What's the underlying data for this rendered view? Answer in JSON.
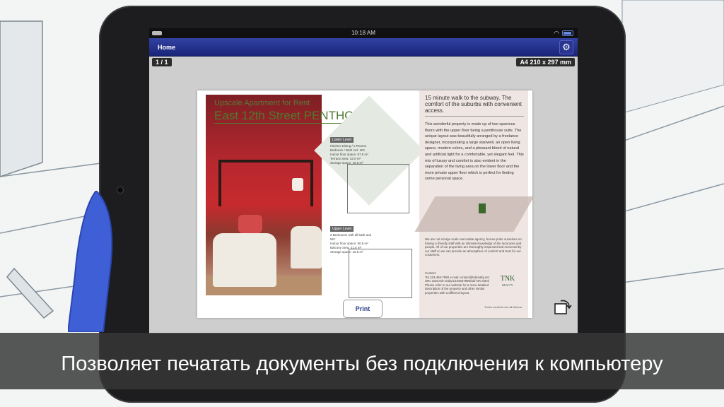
{
  "status_bar": {
    "time": "10:18 AM"
  },
  "nav": {
    "home_label": "Home"
  },
  "toolbar": {
    "page_indicator": "1 / 1",
    "paper_size": "A4 210 x 297 mm",
    "print_label": "Print"
  },
  "document": {
    "kicker": "Upscale Apartment for Rent",
    "headline": "East 12th Street PENTHOUSE",
    "lower_level": {
      "label": "Lower Level",
      "details": "Kitchen-Dining / 2 Rooms\nBedroom / Bath incl. WC\nIndoor floor space: 57.5 m²\nTerrace area: 42.0 m²\nStorage space: 15.5 m²"
    },
    "upper_level": {
      "label": "Upper Level",
      "details": "2 Bedrooms with all bath and WC\nIndoor floor space: 50.5 m²\nBalcony area: 21.5 m²\nStorage space: 15.5 m²"
    },
    "right_heading": "15 minute walk to the subway. The comfort of the suburbs with convenient access.",
    "right_body": "This wonderful property is made up of two spacious floors with the upper floor being a penthouse suite. The unique layout was beautifully arranged by a freelance designer, incorporating a large stairwell, an open living space, modern colors, and a pleasant blend of natural and artificial light for a comfortable, yet elegant feel. This mix of luxury and comfort is also evident in the separation of the living area on the lower floor and the more private upper floor which is perfect for finding some personal space.",
    "agency_text": "We are not a large scale real estate agency, but we pride ourselves on having a friendly staff with an intimate knowledge of the local area and people. All of our properties are thoroughly inspected and screened by our staff so we can provide an atmosphere of comfort and trust for our customers.",
    "contact_label": "Contact",
    "contact_text": "Tel 123-456-7890 e-mail contact@tnkrealty.net URL www.tnk-realty/1234567890/ad/-OK.shtml Please refer to our website for a more detailed description of the property and other similar properties with a different layout.",
    "logo_text": "TNK",
    "logo_sub": "REALTY",
    "footnote": "These contents are all fictions."
  },
  "subtitle": "Позволяет печатать документы без подключения к компьютеру",
  "colors": {
    "navbar": "#2a3590",
    "accent_green": "#4f7a2f",
    "subtitle_bar": "#373737"
  }
}
